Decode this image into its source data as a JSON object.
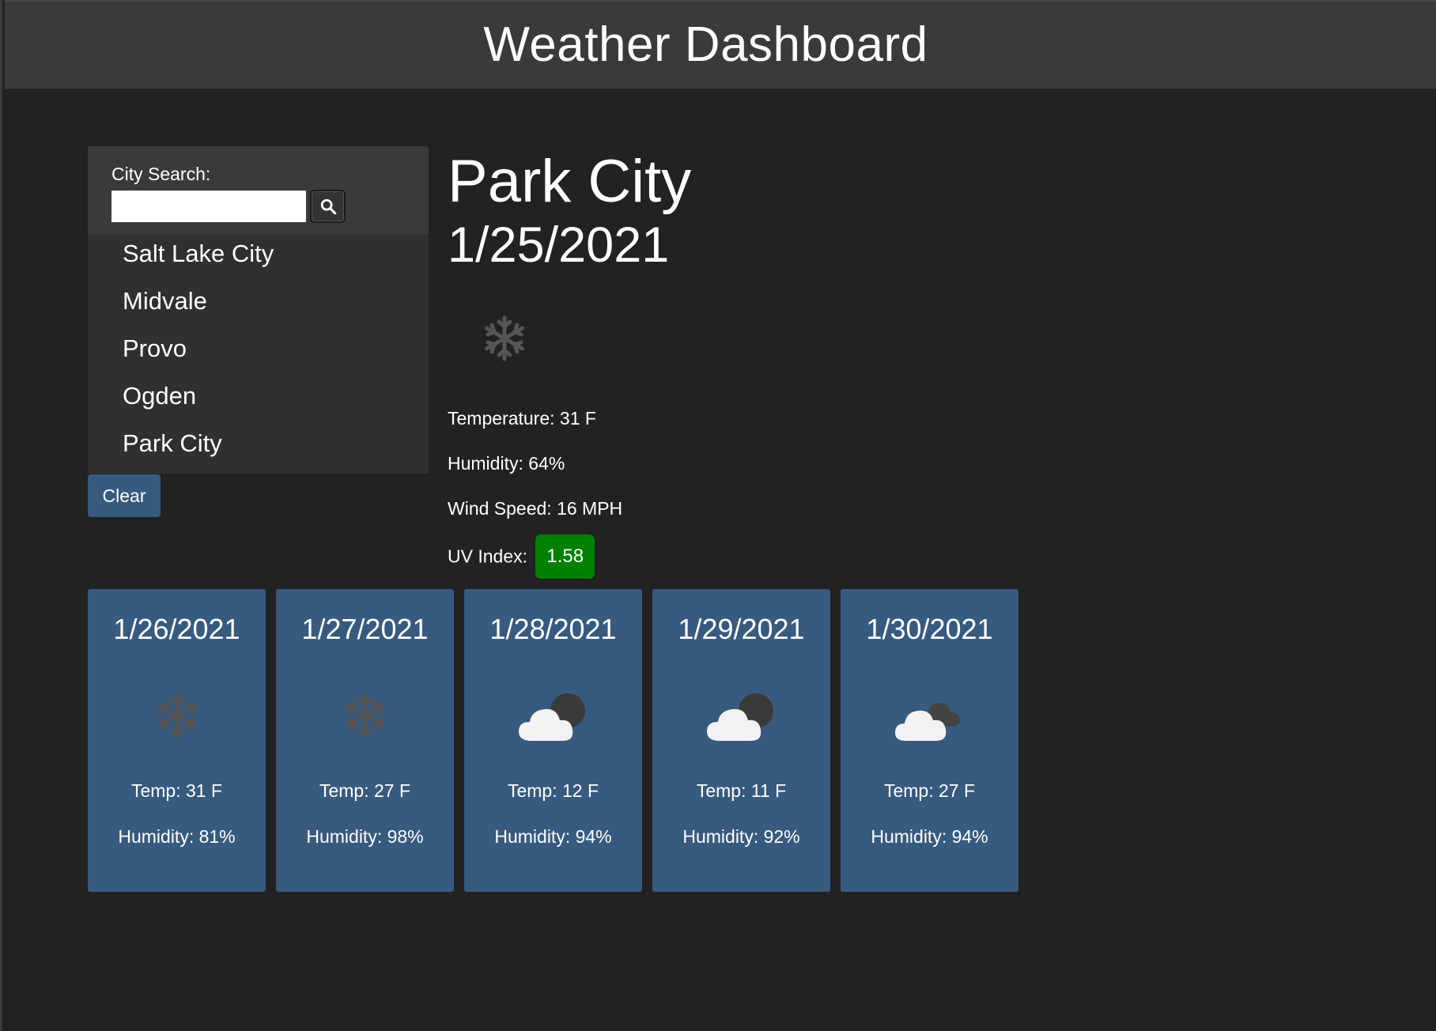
{
  "header": {
    "title": "Weather Dashboard"
  },
  "search": {
    "label": "City Search:",
    "value": "",
    "placeholder": "",
    "button_icon": "search-icon"
  },
  "cities": [
    {
      "label": "Salt Lake City"
    },
    {
      "label": "Midvale"
    },
    {
      "label": "Provo"
    },
    {
      "label": "Ogden"
    },
    {
      "label": "Park City"
    }
  ],
  "clear_label": "Clear",
  "current": {
    "city": "Park City",
    "date": "1/25/2021",
    "icon": "snow-icon",
    "temperature": "Temperature: 31 F",
    "humidity": "Humidity: 64%",
    "wind": "Wind Speed: 16 MPH",
    "uv_label": "UV Index:",
    "uv_value": "1.58",
    "uv_color": "#008000"
  },
  "forecast": [
    {
      "date": "1/26/2021",
      "icon": "snow-icon",
      "temp": "Temp: 31 F",
      "humidity": "Humidity: 81%"
    },
    {
      "date": "1/27/2021",
      "icon": "snow-icon",
      "temp": "Temp: 27 F",
      "humidity": "Humidity: 98%"
    },
    {
      "date": "1/28/2021",
      "icon": "night-cloud-icon",
      "temp": "Temp: 12 F",
      "humidity": "Humidity: 94%"
    },
    {
      "date": "1/29/2021",
      "icon": "night-cloud-icon",
      "temp": "Temp: 11 F",
      "humidity": "Humidity: 92%"
    },
    {
      "date": "1/30/2021",
      "icon": "broken-clouds-icon",
      "temp": "Temp: 27 F",
      "humidity": "Humidity: 94%"
    }
  ],
  "colors": {
    "background": "#222222",
    "header": "#3a3a3a",
    "card": "#375a7f",
    "uv_favorable": "#008000"
  }
}
